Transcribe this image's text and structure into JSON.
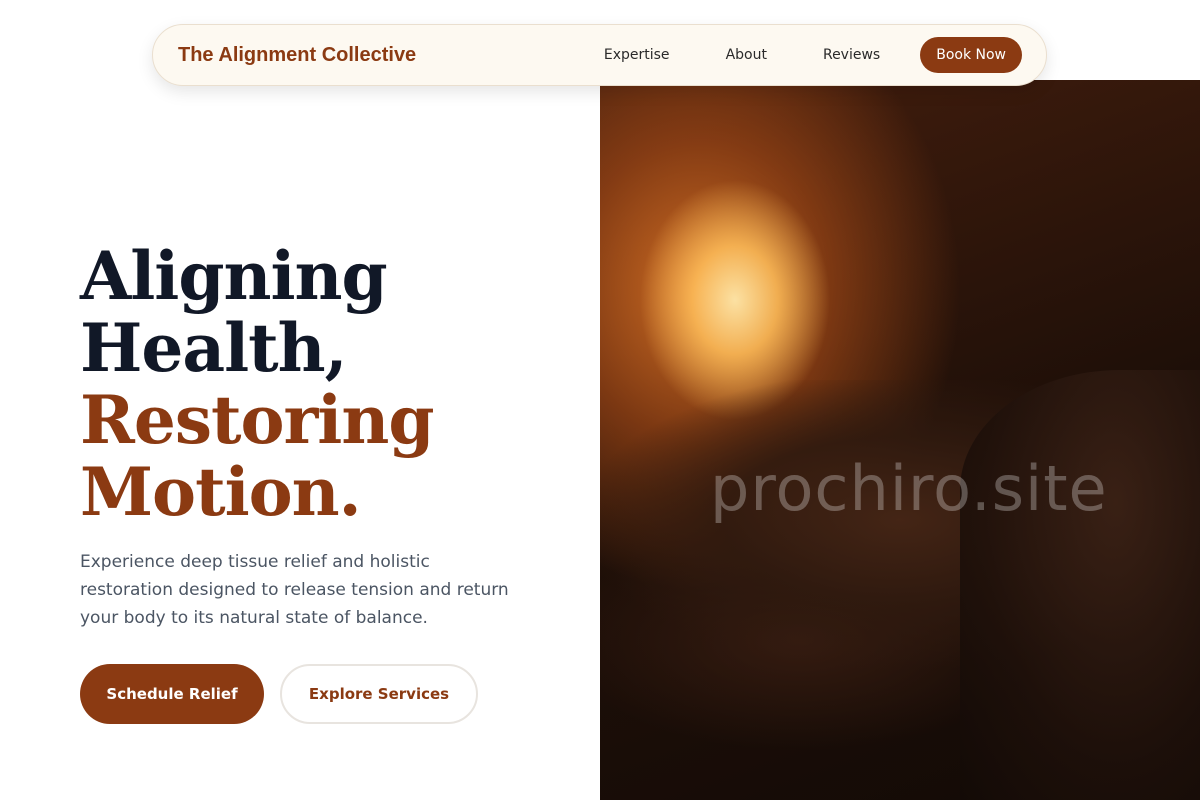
{
  "nav": {
    "brand": "The Alignment Collective",
    "links": [
      "Expertise",
      "About",
      "Reviews"
    ],
    "cta": "Book Now"
  },
  "hero": {
    "headline_dark_1": "Aligning",
    "headline_dark_2": "Health,",
    "headline_accent_1": "Restoring",
    "headline_accent_2": "Motion.",
    "description": "Experience deep tissue relief and holistic restoration designed to release tension and return your body to its natural state of balance.",
    "primary_button": "Schedule Relief",
    "secondary_button": "Explore Services",
    "watermark": "prochiro.site"
  },
  "colors": {
    "brand": "#8b3a12",
    "heading": "#111827",
    "body_text": "#4b5563",
    "nav_bg": "#fdf9f1"
  }
}
